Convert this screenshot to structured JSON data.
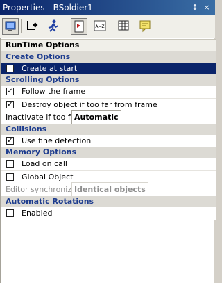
{
  "window": {
    "title": "Properties - BSoldier1",
    "pin_glyph": "↕",
    "close_glyph": "×"
  },
  "toolbar": {
    "buttons": [
      {
        "icon": "monitor-icon",
        "active": true
      },
      {
        "icon": "movement-icon",
        "active": false
      },
      {
        "icon": "running-man-icon",
        "active": false
      },
      {
        "icon": "document-icon",
        "active": true
      },
      {
        "icon": "az-sort-icon",
        "active": false,
        "text": "A→Z"
      },
      {
        "icon": "grid-icon",
        "active": false
      },
      {
        "icon": "comment-icon",
        "active": false
      }
    ]
  },
  "section_header": "RunTime Options",
  "properties": {
    "create_options": {
      "category": "Create Options",
      "create_at_start": {
        "label": "Create at start",
        "checked": false,
        "selected": true
      }
    },
    "scrolling_options": {
      "category": "Scrolling Options",
      "follow_frame": {
        "label": "Follow the frame",
        "checked": true
      },
      "destroy_far": {
        "label": "Destroy object if too far from frame",
        "checked": true
      },
      "inactivate_far": {
        "label": "Inactivate if too far from window",
        "value": "Automatic"
      }
    },
    "collisions": {
      "category": "Collisions",
      "fine_detection": {
        "label": "Use fine detection",
        "checked": true
      }
    },
    "memory_options": {
      "category": "Memory Options",
      "load_on_call": {
        "label": "Load on call",
        "checked": false
      },
      "global_object": {
        "label": "Global Object",
        "checked": false
      },
      "editor_sync": {
        "label": "Editor synchronization",
        "value": "Identical objects"
      }
    },
    "automatic_rotations": {
      "category": "Automatic Rotations",
      "enabled": {
        "label": "Enabled",
        "checked": false
      }
    }
  },
  "colors": {
    "selection": "#0a246a",
    "category_text": "#1d3c8e",
    "window_bg": "#d4d0c8"
  }
}
